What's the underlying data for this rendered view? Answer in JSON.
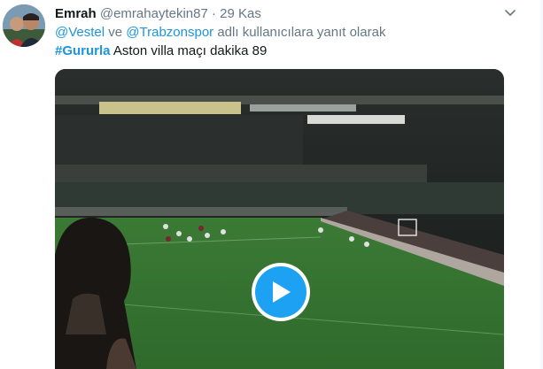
{
  "tweet": {
    "author_name": "Emrah",
    "author_handle": "@emrahaytekin87",
    "separator": "·",
    "timestamp": "29 Kas",
    "reply_to": {
      "mention_1": "@Vestel",
      "connector": "ve",
      "mention_2": "@Trabzonspor",
      "suffix": "adlı kullanıcılara yanıt olarak"
    },
    "hashtag": "#Gururla",
    "text": "Aston villa maçı dakika 89"
  },
  "icons": {
    "avatar": "profile-photo",
    "caret": "chevron-down-icon",
    "play": "play-icon"
  },
  "colors": {
    "link": "#1b95e0",
    "play_button": "#1da1f2",
    "muted_text": "#657786"
  }
}
